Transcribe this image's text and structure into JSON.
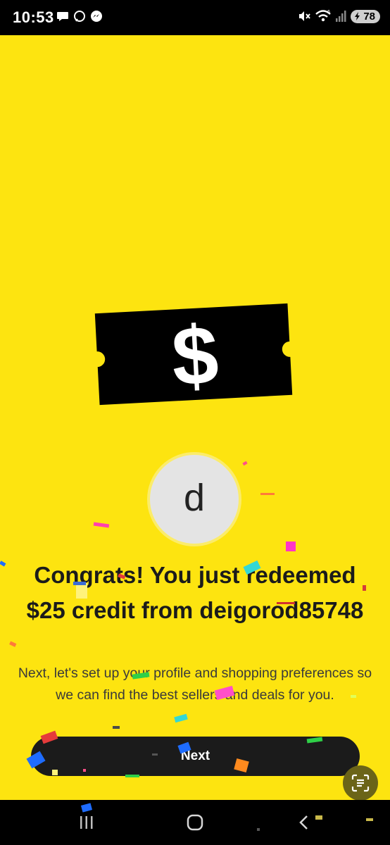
{
  "status_bar": {
    "time": "10:53",
    "battery": "78",
    "left_icons": [
      "chat-bubble-icon",
      "messenger-outline-icon",
      "messenger-icon"
    ],
    "right_icons": [
      "mute-icon",
      "wifi-icon",
      "signal-icon",
      "battery-icon"
    ]
  },
  "main": {
    "background_color": "#fde410",
    "ticket_icon": "dollar-ticket-icon",
    "ticket_symbol": "$",
    "avatar_letter": "d",
    "headline": "Congrats! You just redeemed $25 credit from deigorod85748",
    "subtext": "Next, let's set up your profile and shopping preferences so we can find the best sellers and deals for you.",
    "next_label": "Next",
    "scan_icon": "text-scan-icon"
  },
  "nav_bar": {
    "items": [
      "recents-icon",
      "home-icon",
      "back-icon"
    ]
  }
}
